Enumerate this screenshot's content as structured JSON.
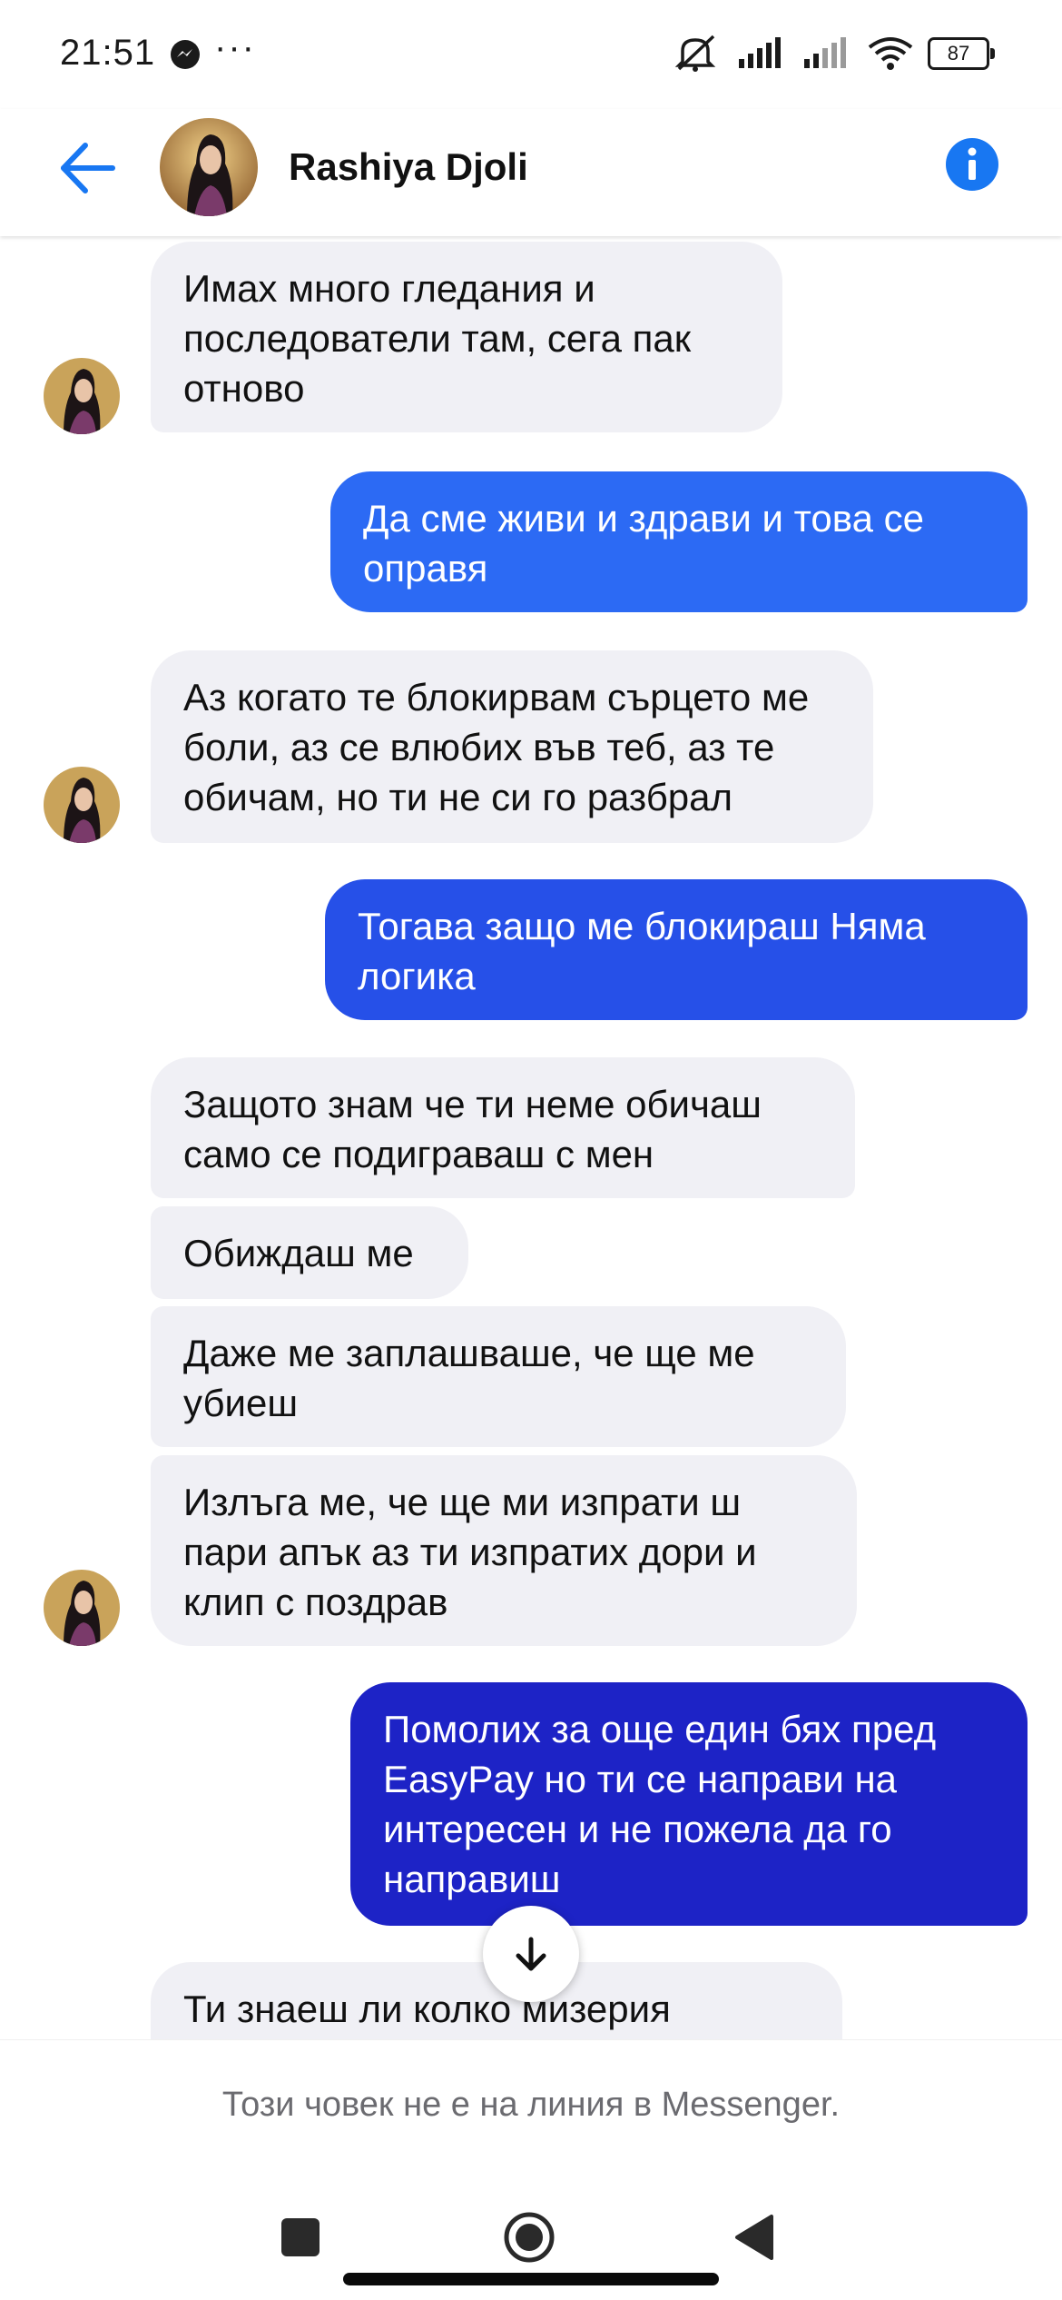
{
  "status_bar": {
    "time": "21:51",
    "dots": "···",
    "battery": "87",
    "icons": [
      "messenger-icon",
      "mute-icon",
      "signal-icon",
      "signal-icon",
      "wifi-icon",
      "battery-icon"
    ]
  },
  "header": {
    "contact_name": "Rashiya Djoli",
    "icons": [
      "back-arrow-icon",
      "info-icon"
    ]
  },
  "messages": [
    {
      "side": "in",
      "text": "Имах много гледания и последователи там, сега пак отново"
    },
    {
      "side": "out",
      "text": "Да сме живи и здрави и това се оправя"
    },
    {
      "side": "in",
      "text": "Аз когато те блокирвам сърцето ме боли, аз се влюбих във теб, аз те обичам, но ти не си го разбрал"
    },
    {
      "side": "out",
      "text": "Тогава защо ме блокираш Няма логика"
    },
    {
      "side": "in",
      "text": "Защото знам че ти неме обичаш само се подиграваш с мен"
    },
    {
      "side": "in",
      "text": "Обиждаш ме"
    },
    {
      "side": "in",
      "text": "Даже ме заплашваше, че ще ме убиеш"
    },
    {
      "side": "in",
      "text": "Излъга ме, че ще ми изпрати ш пари апък аз ти изпратих дори и клип с поздрав"
    },
    {
      "side": "out",
      "text": "Помолих за още един бях пред EasyPay но ти се направи на интересен и не пожела да го направиш"
    },
    {
      "side": "in",
      "text": "Ти знаеш ли колко мизерия"
    }
  ],
  "colors": {
    "accent": "#1877f2",
    "incoming_bubble": "#f0f0f5",
    "outgoing_top": "#2f6af2",
    "outgoing_bottom": "#1a1fc0"
  },
  "footer": {
    "offline_notice": "Този човек не е на линия в Messenger."
  }
}
